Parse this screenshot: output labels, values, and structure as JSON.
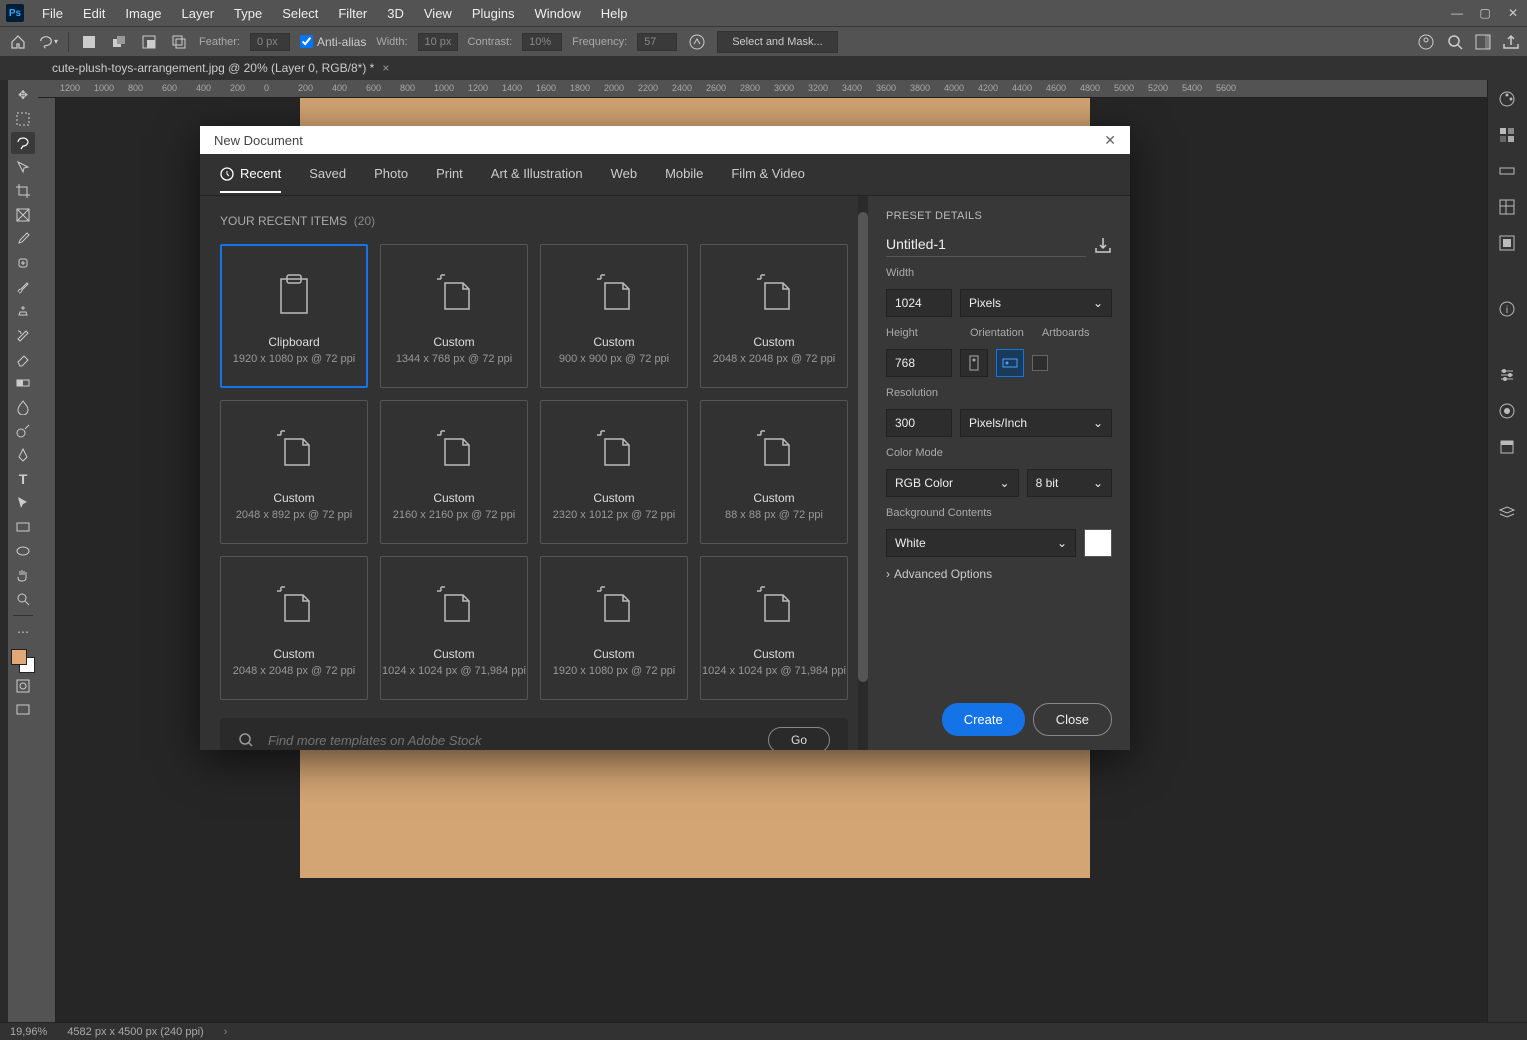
{
  "menubar": {
    "items": [
      "File",
      "Edit",
      "Image",
      "Layer",
      "Type",
      "Select",
      "Filter",
      "3D",
      "View",
      "Plugins",
      "Window",
      "Help"
    ]
  },
  "optbar": {
    "feather_label": "Feather:",
    "feather_value": "0 px",
    "antialias_label": "Anti-alias",
    "width_label": "Width:",
    "width_value": "10 px",
    "contrast_label": "Contrast:",
    "contrast_value": "10%",
    "frequency_label": "Frequency:",
    "frequency_value": "57",
    "selectmask": "Select and Mask..."
  },
  "tab": {
    "title": "cute-plush-toys-arrangement.jpg @ 20% (Layer 0, RGB/8*) *"
  },
  "ruler_h": [
    "1200",
    "1000",
    "800",
    "600",
    "400",
    "200",
    "0",
    "200",
    "400",
    "600",
    "800",
    "1000",
    "1200",
    "1400",
    "1600",
    "1800",
    "2000",
    "2200",
    "2400",
    "2600",
    "2800",
    "3000",
    "3200",
    "3400",
    "3600",
    "3800",
    "4000",
    "4200",
    "4400",
    "4600",
    "4800",
    "5000",
    "5200",
    "5400",
    "5600"
  ],
  "status": {
    "zoom": "19,96%",
    "docinfo": "4582 px x 4500 px (240 ppi)"
  },
  "dialog": {
    "title": "New Document",
    "tabs": [
      "Recent",
      "Saved",
      "Photo",
      "Print",
      "Art & Illustration",
      "Web",
      "Mobile",
      "Film & Video"
    ],
    "recent_header": "YOUR RECENT ITEMS",
    "recent_count": "(20)",
    "presets": [
      {
        "name": "Clipboard",
        "dim": "1920 x 1080 px @ 72 ppi",
        "type": "clip",
        "selected": true
      },
      {
        "name": "Custom",
        "dim": "1344 x 768 px @ 72 ppi",
        "type": "doc"
      },
      {
        "name": "Custom",
        "dim": "900 x 900 px @ 72 ppi",
        "type": "doc"
      },
      {
        "name": "Custom",
        "dim": "2048 x 2048 px @ 72 ppi",
        "type": "doc"
      },
      {
        "name": "Custom",
        "dim": "2048 x 892 px @ 72 ppi",
        "type": "doc"
      },
      {
        "name": "Custom",
        "dim": "2160 x 2160 px @ 72 ppi",
        "type": "doc"
      },
      {
        "name": "Custom",
        "dim": "2320 x 1012 px @ 72 ppi",
        "type": "doc"
      },
      {
        "name": "Custom",
        "dim": "88 x 88 px @ 72 ppi",
        "type": "doc"
      },
      {
        "name": "Custom",
        "dim": "2048 x 2048 px @ 72 ppi",
        "type": "doc"
      },
      {
        "name": "Custom",
        "dim": "1024 x 1024 px @ 71,984 ppi",
        "type": "doc"
      },
      {
        "name": "Custom",
        "dim": "1920 x 1080 px @ 72 ppi",
        "type": "doc"
      },
      {
        "name": "Custom",
        "dim": "1024 x 1024 px @ 71,984 ppi",
        "type": "doc"
      }
    ],
    "stock_placeholder": "Find more templates on Adobe Stock",
    "go": "Go",
    "details": {
      "header": "PRESET DETAILS",
      "name": "Untitled-1",
      "width_label": "Width",
      "width": "1024",
      "width_unit": "Pixels",
      "height_label": "Height",
      "height": "768",
      "orientation_label": "Orientation",
      "artboards_label": "Artboards",
      "resolution_label": "Resolution",
      "resolution": "300",
      "resolution_unit": "Pixels/Inch",
      "colormode_label": "Color Mode",
      "colormode": "RGB Color",
      "colordepth": "8 bit",
      "bgcontents_label": "Background Contents",
      "bgcontents": "White",
      "advanced": "Advanced Options",
      "create": "Create",
      "close": "Close"
    }
  }
}
